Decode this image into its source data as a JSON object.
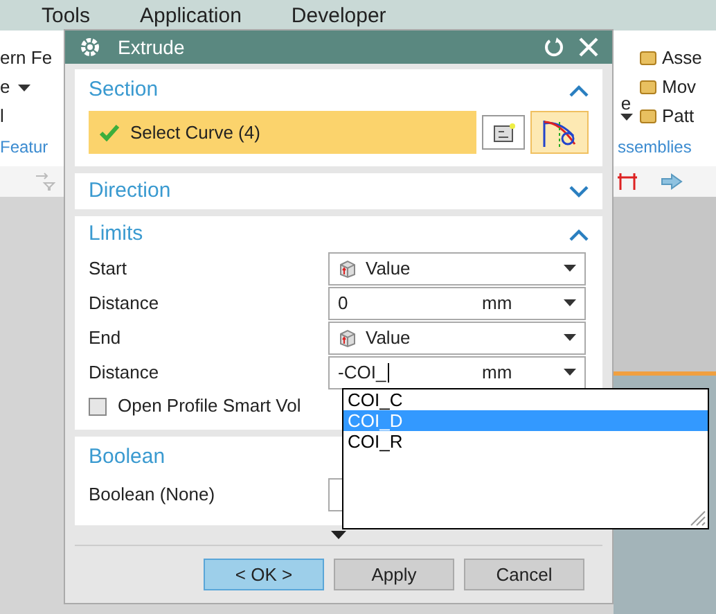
{
  "menu_bar": [
    "Tools",
    "Application",
    "Developer"
  ],
  "ribbon_left": {
    "items": [
      {
        "label": "ern Fe",
        "dropdown": false
      },
      {
        "label": "e",
        "dropdown": true
      },
      {
        "label": "l",
        "dropdown": false
      }
    ],
    "group": "Featur"
  },
  "ribbon_mid": {
    "label": "e",
    "dropdown": true
  },
  "ribbon_right": {
    "items": [
      {
        "label": "Asse"
      },
      {
        "label": "Mov"
      },
      {
        "label": "Patt"
      }
    ],
    "group": "ssemblies"
  },
  "dialog": {
    "title": "Extrude",
    "section": {
      "title": "Section",
      "expanded": true,
      "selector": {
        "label": "Select Curve (4)",
        "done": true
      }
    },
    "direction": {
      "title": "Direction",
      "expanded": false
    },
    "limits": {
      "title": "Limits",
      "expanded": true,
      "rows": [
        {
          "label": "Start",
          "kind": "select",
          "value": "Value"
        },
        {
          "label": "Distance",
          "kind": "number",
          "value": "0",
          "unit": "mm"
        },
        {
          "label": "End",
          "kind": "select",
          "value": "Value"
        },
        {
          "label": "Distance",
          "kind": "number",
          "value": "-COI_",
          "unit": "mm",
          "editing": true
        }
      ],
      "checkbox": {
        "label": "Open Profile Smart Vol",
        "checked": false
      }
    },
    "boolean": {
      "title": "Boolean",
      "rows": [
        {
          "label": "Boolean (None)"
        }
      ]
    },
    "buttons": [
      {
        "label": "< OK >",
        "default": true
      },
      {
        "label": "Apply",
        "default": false
      },
      {
        "label": "Cancel",
        "default": false
      }
    ]
  },
  "dropdown_list": [
    {
      "label": "COI_C",
      "selected": false
    },
    {
      "label": "COI_D",
      "selected": true
    },
    {
      "label": "COI_R",
      "selected": false
    }
  ]
}
